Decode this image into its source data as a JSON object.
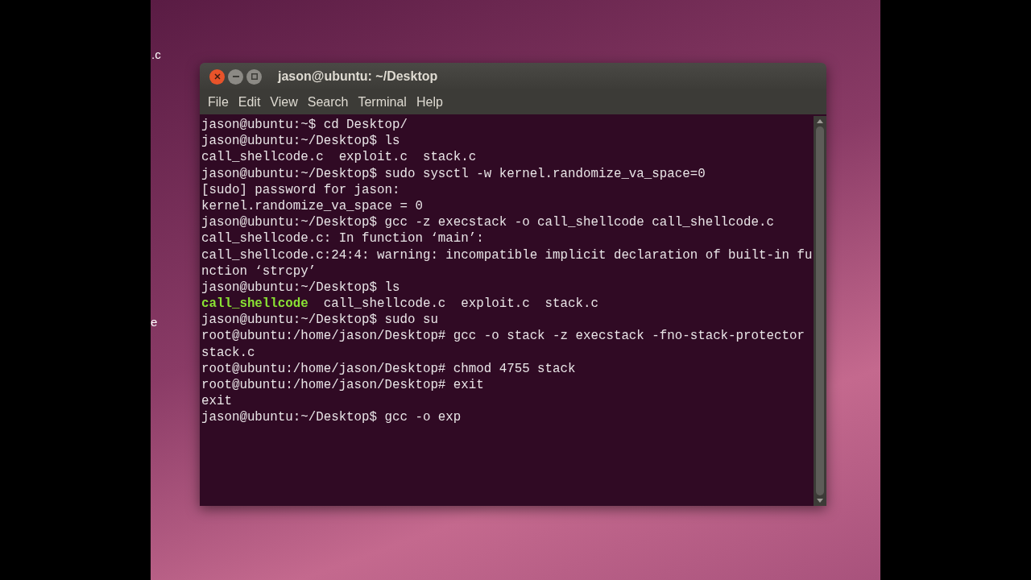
{
  "desktop": {
    "icon_labels": [
      ".c",
      "e"
    ]
  },
  "window": {
    "title": "jason@ubuntu: ~/Desktop",
    "menu": [
      "File",
      "Edit",
      "View",
      "Search",
      "Terminal",
      "Help"
    ],
    "lines": [
      [
        {
          "text": "jason@ubuntu:~$ cd Desktop/",
          "kind": "plain"
        }
      ],
      [
        {
          "text": "jason@ubuntu:~/Desktop$ ls",
          "kind": "plain"
        }
      ],
      [
        {
          "text": "call_shellcode.c  exploit.c  stack.c",
          "kind": "plain"
        }
      ],
      [
        {
          "text": "jason@ubuntu:~/Desktop$ sudo sysctl -w kernel.randomize_va_space=0",
          "kind": "plain"
        }
      ],
      [
        {
          "text": "[sudo] password for jason:",
          "kind": "plain"
        }
      ],
      [
        {
          "text": "kernel.randomize_va_space = 0",
          "kind": "plain"
        }
      ],
      [
        {
          "text": "jason@ubuntu:~/Desktop$ gcc -z execstack -o call_shellcode call_shellcode.c",
          "kind": "plain"
        }
      ],
      [
        {
          "text": "call_shellcode.c: In function ‘main’:",
          "kind": "plain"
        }
      ],
      [
        {
          "text": "call_shellcode.c:24:4: warning: incompatible implicit declaration of built-in fu",
          "kind": "plain"
        }
      ],
      [
        {
          "text": "nction ‘strcpy’",
          "kind": "plain"
        }
      ],
      [
        {
          "text": "jason@ubuntu:~/Desktop$ ls",
          "kind": "plain"
        }
      ],
      [
        {
          "text": "call_shellcode",
          "kind": "executable"
        },
        {
          "text": "  call_shellcode.c  exploit.c  stack.c",
          "kind": "plain"
        }
      ],
      [
        {
          "text": "jason@ubuntu:~/Desktop$ sudo su",
          "kind": "plain"
        }
      ],
      [
        {
          "text": "root@ubuntu:/home/jason/Desktop# gcc -o stack -z execstack -fno-stack-protector",
          "kind": "plain"
        }
      ],
      [
        {
          "text": "stack.c",
          "kind": "plain"
        }
      ],
      [
        {
          "text": "root@ubuntu:/home/jason/Desktop# chmod 4755 stack",
          "kind": "plain"
        }
      ],
      [
        {
          "text": "root@ubuntu:/home/jason/Desktop# exit",
          "kind": "plain"
        }
      ],
      [
        {
          "text": "exit",
          "kind": "plain"
        }
      ],
      [
        {
          "text": "jason@ubuntu:~/Desktop$ gcc -o exp",
          "kind": "plain"
        }
      ]
    ]
  }
}
